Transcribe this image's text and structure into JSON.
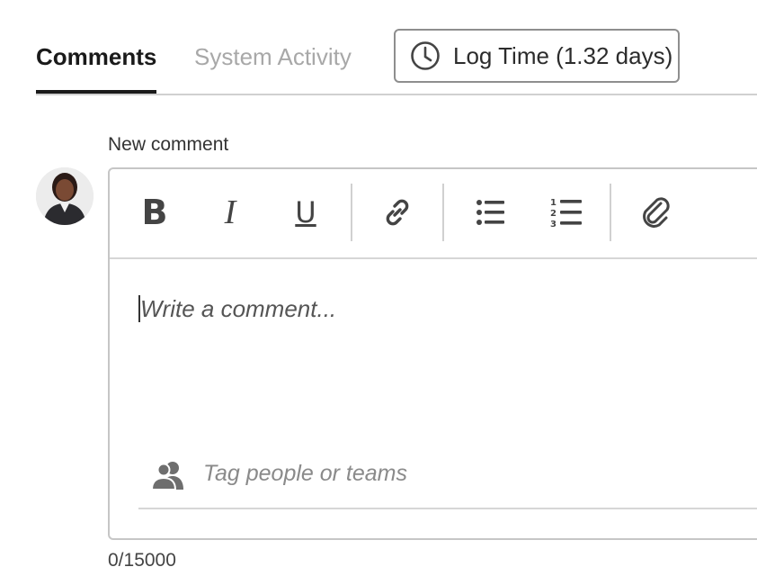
{
  "tabs": [
    {
      "label": "Comments",
      "active": true
    },
    {
      "label": "System Activity",
      "active": false
    }
  ],
  "log_time": {
    "label": "Log Time (1.32 days)",
    "icon": "clock-icon"
  },
  "comment": {
    "label": "New comment",
    "placeholder": "Write a comment...",
    "toolbar": [
      {
        "name": "bold",
        "glyph": "B"
      },
      {
        "name": "italic",
        "glyph": "I"
      },
      {
        "name": "underline",
        "glyph": "U"
      },
      {
        "name": "link",
        "icon": "link-icon"
      },
      {
        "name": "bullet-list",
        "icon": "bullet-list-icon"
      },
      {
        "name": "numbered-list",
        "icon": "numbered-list-icon"
      },
      {
        "name": "attachment",
        "icon": "paperclip-icon"
      }
    ],
    "tag_placeholder": "Tag people or teams",
    "counter": "0/15000"
  },
  "colors": {
    "active_tab": "#1a1a1a",
    "inactive_tab": "#a8a8a8",
    "border": "#c6c6c6"
  }
}
